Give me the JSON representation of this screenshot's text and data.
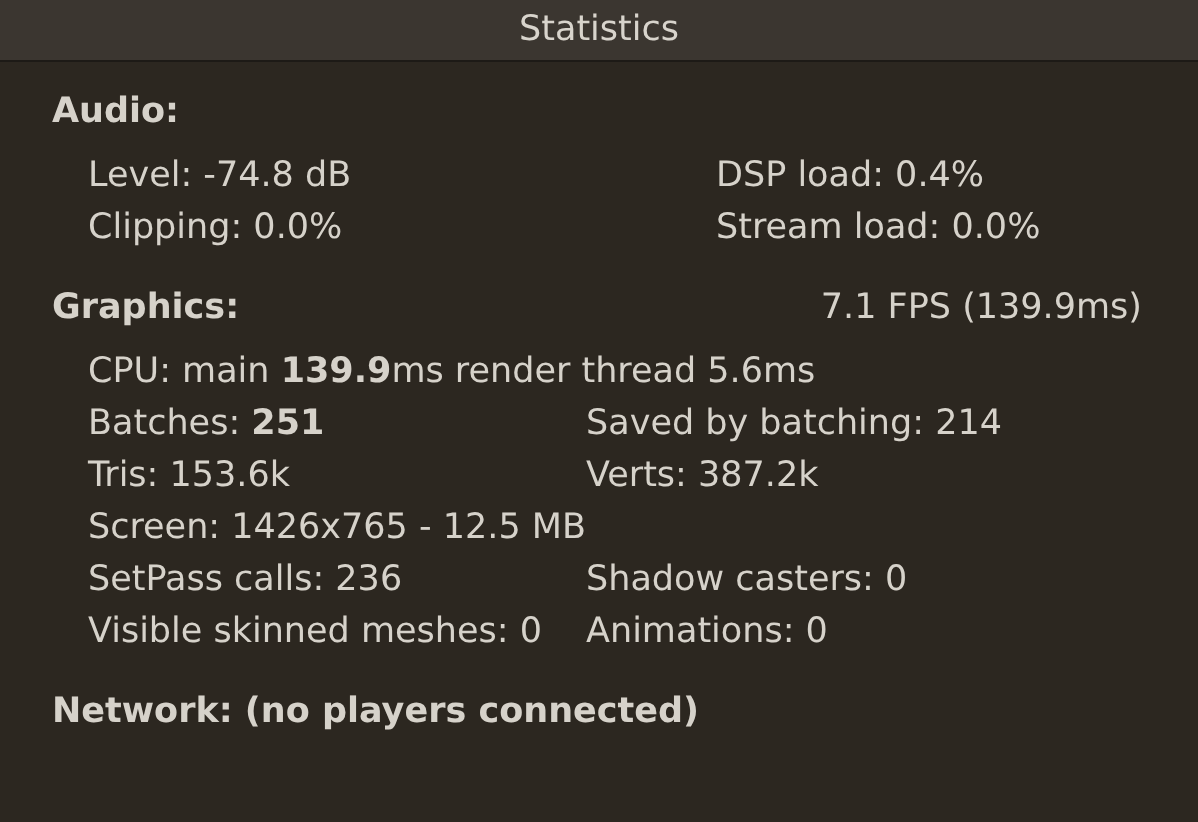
{
  "window": {
    "title": "Statistics"
  },
  "sections": [
    {
      "heading": "Audio:",
      "rows": [
        {
          "kind": "pair",
          "cells": [
            "Level: -74.8 dB",
            "DSP load: 0.4%"
          ]
        },
        {
          "kind": "pair",
          "cells": [
            "Clipping: 0.0%",
            "Stream load: 0.0%"
          ]
        }
      ]
    },
    {
      "heading": "Graphics:",
      "aside": "7.1 FPS (139.9ms)",
      "rows": [
        {
          "kind": "line",
          "cells": [
            "CPU: main **139.9**ms  render thread 5.6ms"
          ]
        },
        {
          "kind": "split",
          "cells": [
            "Batches: **251**",
            "Saved by batching: 214"
          ]
        },
        {
          "kind": "split",
          "cells": [
            "Tris: 153.6k",
            "Verts: 387.2k"
          ]
        },
        {
          "kind": "line",
          "cells": [
            "Screen: 1426x765 - 12.5 MB"
          ]
        },
        {
          "kind": "split",
          "cells": [
            "SetPass calls: 236",
            "Shadow casters: 0"
          ]
        },
        {
          "kind": "split",
          "cells": [
            "Visible skinned meshes: 0",
            "Animations: 0"
          ]
        }
      ]
    },
    {
      "heading": "Network: (no players connected)"
    }
  ]
}
